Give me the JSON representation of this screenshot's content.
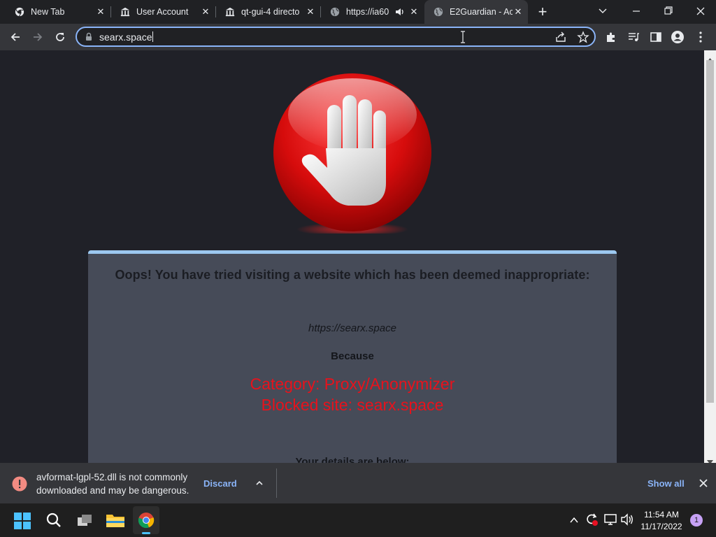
{
  "tabs": [
    {
      "title": "New Tab",
      "favicon": "chrome-icon"
    },
    {
      "title": "User Account",
      "favicon": "institution-icon"
    },
    {
      "title": "qt-gui-4 directo",
      "favicon": "institution-icon"
    },
    {
      "title": "https://ia60",
      "favicon": "globe-icon",
      "audio": "speaker-icon"
    },
    {
      "title": "E2Guardian - Ac",
      "favicon": "globe-icon",
      "active": true
    }
  ],
  "address_bar": {
    "url": "searx.space"
  },
  "page": {
    "heading": "Oops! You have tried visiting a website which has been deemed inappropriate:",
    "blocked_url": "https://searx.space",
    "because": "Because",
    "category": "Category: Proxy/Anonymizer",
    "blocked_site": "Blocked site: searx.space",
    "details": "Your details are below:"
  },
  "download": {
    "message_line1": "avformat-lgpl-52.dll is not commonly",
    "message_line2": "downloaded and may be dangerous.",
    "discard_label": "Discard",
    "show_all_label": "Show all"
  },
  "taskbar": {
    "time": "11:54 AM",
    "date": "11/17/2022",
    "notification_count": "1"
  },
  "colors": {
    "accent": "#8ab4f8",
    "panel": "#464b58",
    "warning_red": "#e8121c",
    "danger_icon": "#f28b82"
  }
}
